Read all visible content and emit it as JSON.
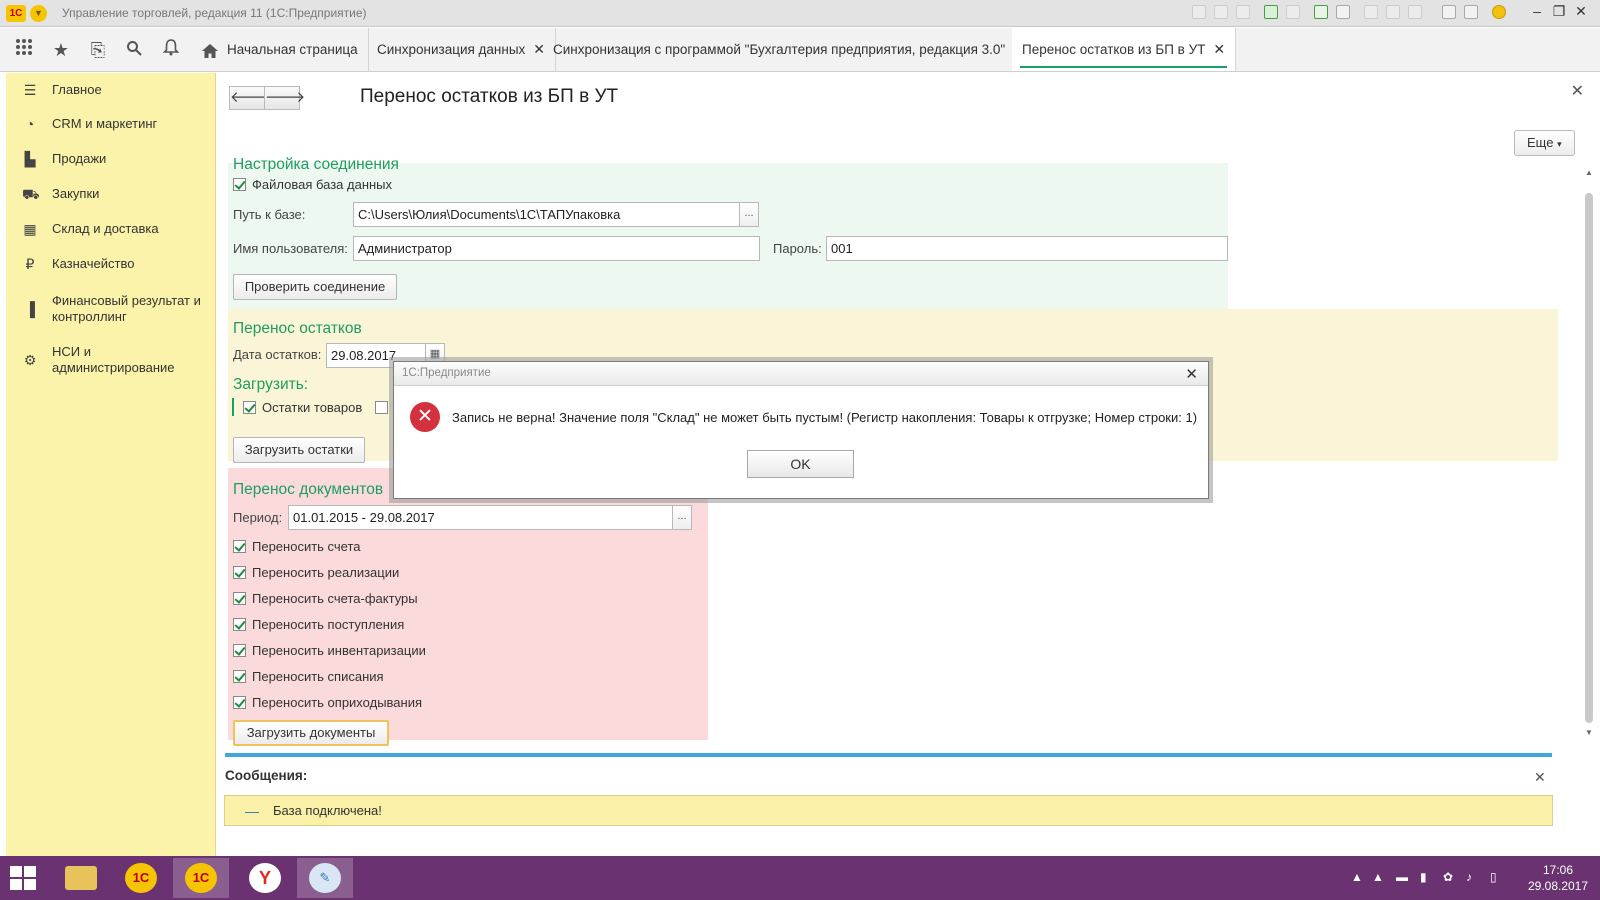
{
  "titlebar": {
    "logo": "1С",
    "title": "Управление торговлей, редакция 11  (1С:Предприятие)",
    "window_controls": [
      "–",
      "❐",
      "✕"
    ]
  },
  "toolbar": {
    "icons": [
      "apps-grid-icon",
      "star-icon",
      "history-icon",
      "search-icon",
      "bell-icon"
    ]
  },
  "tabs": [
    {
      "label": "Начальная страница",
      "closable": false,
      "active": false
    },
    {
      "label": "Синхронизация данных",
      "closable": true,
      "active": false
    },
    {
      "label": "Синхронизация с программой \"Бухгалтерия предприятия, редакция 3.0\"",
      "closable": true,
      "active": false
    },
    {
      "label": "Перенос остатков из БП в УТ",
      "closable": true,
      "active": true
    }
  ],
  "sidebar": {
    "items": [
      {
        "label": "Главное",
        "icon": "menu-icon"
      },
      {
        "label": "CRM и маркетинг",
        "icon": "pie-chart-icon"
      },
      {
        "label": "Продажи",
        "icon": "bag-icon"
      },
      {
        "label": "Закупки",
        "icon": "cart-icon"
      },
      {
        "label": "Склад и доставка",
        "icon": "grid-icon"
      },
      {
        "label": "Казначейство",
        "icon": "ruble-icon"
      },
      {
        "label": "Финансовый результат и контроллинг",
        "icon": "bar-chart-icon"
      },
      {
        "label": "НСИ и администрирование",
        "icon": "gear-icon"
      }
    ]
  },
  "form": {
    "title": "Перенос остатков из БП в УТ",
    "more_label": "Еще",
    "connection": {
      "title": "Настройка соединения",
      "file_db_label": "Файловая база данных",
      "file_db_checked": true,
      "path_label": "Путь к базе:",
      "path_value": "C:\\Users\\Юлия\\Documents\\1C\\ТАПУпаковка",
      "user_label": "Имя пользователя:",
      "user_value": "Администратор",
      "password_label": "Пароль:",
      "password_value": "001",
      "check_button": "Проверить соединение"
    },
    "balances": {
      "title": "Перенос остатков",
      "date_label": "Дата остатков:",
      "date_value": "29.08.2017",
      "load_title": "Загрузить:",
      "goods_label": "Остатки товаров",
      "goods_checked": true,
      "load_button": "Загрузить остатки"
    },
    "documents": {
      "title": "Перенос документов",
      "period_label": "Период:",
      "period_value": "01.01.2015 - 29.08.2017",
      "checkboxes": [
        {
          "label": "Переносить счета",
          "checked": true
        },
        {
          "label": "Переносить реализации",
          "checked": true
        },
        {
          "label": "Переносить счета-фактуры",
          "checked": true
        },
        {
          "label": "Переносить поступления",
          "checked": true
        },
        {
          "label": "Переносить инвентаризации",
          "checked": true
        },
        {
          "label": "Переносить списания",
          "checked": true
        },
        {
          "label": "Переносить оприходывания",
          "checked": true
        }
      ],
      "load_button": "Загрузить документы"
    },
    "messages": {
      "title": "Сообщения:",
      "dash": "—",
      "items": [
        "База подключена!"
      ]
    }
  },
  "dialog": {
    "title": "1С:Предприятие",
    "message": "Запись не верна! Значение поля \"Склад\" не может быть пустым! (Регистр накопления: Товары к отгрузке; Номер строки: 1)",
    "ok_label": "OK"
  },
  "taskbar": {
    "apps": [
      "file-explorer-icon",
      "1c-icon",
      "1c-icon",
      "yandex-browser-icon",
      "paint-icon"
    ],
    "time": "17:06",
    "date": "29.08.2017"
  },
  "colors": {
    "sidebar_bg": "#fbf3a9",
    "section_title": "#1f9d5f",
    "connection_bg": "#ecf8f0",
    "balances_bg": "#fbf5d8",
    "documents_bg": "#fadadb",
    "taskbar_bg": "#6a3270",
    "error_red": "#d2313d",
    "accent_blue": "#3fa7d9"
  }
}
